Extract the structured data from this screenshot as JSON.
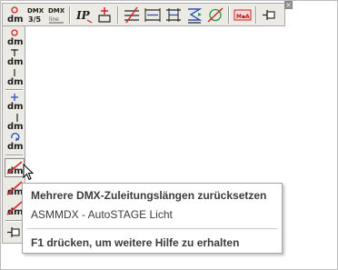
{
  "toolbar_top": {
    "buttons": [
      {
        "icon": "dm-zero-icon",
        "label": "dm"
      },
      {
        "icon": "dmx-35-icon",
        "label": "DMX",
        "sub": "3/5"
      },
      {
        "icon": "dmx-line-icon",
        "label": "DMX",
        "sub": "line"
      },
      {
        "icon": "ip-icon",
        "label": "IP"
      },
      {
        "icon": "plus-insert-icon"
      },
      {
        "icon": "cross-lines-icon"
      },
      {
        "icon": "width-lines-icon"
      },
      {
        "icon": "bracket-lines-icon"
      },
      {
        "icon": "zigzag-icon"
      },
      {
        "icon": "slash-circle-icon"
      },
      {
        "icon": "mia-icon",
        "label": "M▪A"
      },
      {
        "icon": "pin-icon"
      }
    ],
    "close_glyph": "×"
  },
  "toolbar_side": {
    "buttons": [
      {
        "icon": "dm-zero-icon",
        "label": "dm"
      },
      {
        "icon": "dm-arrow-up-icon",
        "label": "dm"
      },
      {
        "icon": "dm-bar-icon",
        "label": "dm"
      },
      {
        "icon": "dm-plus-icon",
        "label": "dm"
      },
      {
        "icon": "dm-line-icon",
        "label": "dm"
      },
      {
        "icon": "dm-refresh-icon",
        "label": "dm"
      },
      {
        "icon": "dm-reset-multi-icon",
        "label": "dm",
        "active": true
      },
      {
        "icon": "dm-reset-icon",
        "label": "dm"
      },
      {
        "icon": "dm-reset-alt-icon",
        "label": "dm"
      },
      {
        "icon": "pin-icon"
      }
    ]
  },
  "tooltip": {
    "title": "Mehrere DMX-Zuleitungslängen zurücksetzen",
    "subtitle": "ASMMDX - AutoSTAGE Licht",
    "help": "F1 drücken, um weitere Hilfe zu erhalten"
  },
  "colors": {
    "toolbar_bg": "#eceae5",
    "icon_red": "#d42020",
    "icon_blue": "#2a52b8",
    "text": "#3c3c3c"
  }
}
